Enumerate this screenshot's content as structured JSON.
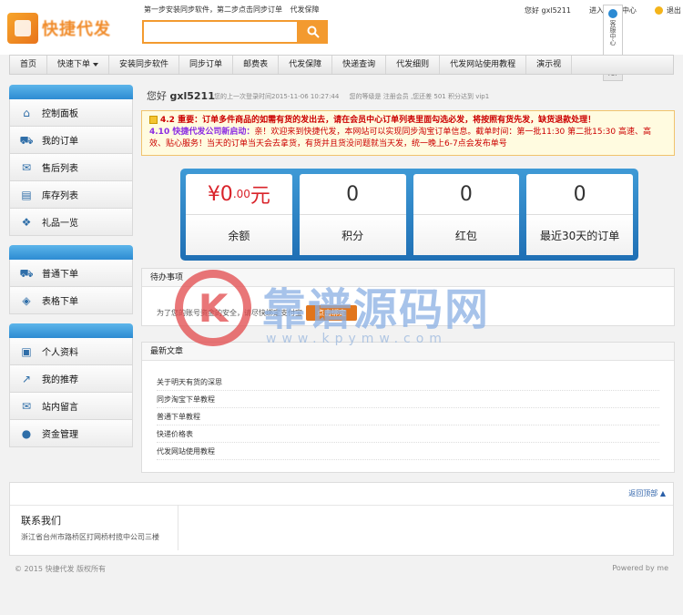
{
  "header": {
    "logo_text": "快捷代发",
    "tip_step": "第一步安装同步软件，第二步点击同步订单",
    "tip_link": "代发保障",
    "search_placeholder": "",
    "user_greeting": "您好 gxl5211",
    "enter_label": "进入",
    "center_label": "中心",
    "logout_label": "退出"
  },
  "service": {
    "label": "客服中心",
    "top": "TOP"
  },
  "nav": {
    "items": [
      "首页",
      "快速下单",
      "安装同步软件",
      "同步订单",
      "邮费表",
      "代发保障",
      "快递查询",
      "代发细则",
      "代发网站使用教程",
      "演示视"
    ]
  },
  "sidebar": {
    "group1": [
      "控制面板",
      "我的订单",
      "售后列表",
      "库存列表",
      "礼品一览"
    ],
    "group2": [
      "普通下单",
      "表格下单"
    ],
    "group3": [
      "个人资料",
      "我的推荐",
      "站内留言",
      "资金管理"
    ]
  },
  "main": {
    "greet_prefix": "您好",
    "username": "gxl5211",
    "last_login": "您的上一次登录时间2015-11-06 10:27:44",
    "level_info": "您的等级是 注册会员 ,您还差 501 积分达到 vip1",
    "notice1_tag": "4.2 重要：",
    "notice1_text": "订单多件商品的如需有货的发出去，请在会员中心订单列表里面勾选必发，将按照有货先发，缺货退款处理！",
    "notice2_tag": "4.10 快捷代发公司新启动：",
    "notice2_text": "亲！欢迎来到快捷代发，本网站可以实现同步淘宝订单信息。截单时间：第一批11:30 第二批15:30 高速、高效、贴心服务！当天的订单当天会去拿货，有货并且货没问题就当天发，统一晚上6-7点会发布单号",
    "stats": [
      {
        "value": "¥0",
        "decimal": ".00",
        "unit": "元",
        "label": "余额"
      },
      {
        "value": "0",
        "label": "积分"
      },
      {
        "value": "0",
        "label": "红包"
      },
      {
        "value": "0",
        "label": "最近30天的订单"
      }
    ],
    "todo_title": "待办事项",
    "todo_text": "为了您的账号资金的安全，请尽快绑定支付宝",
    "todo_button": "点击绑定",
    "articles_title": "最新文章",
    "articles": [
      "关于明天有货的深思",
      "同步淘宝下单教程",
      "普通下单教程",
      "快递价格表",
      "代发网站使用教程"
    ]
  },
  "watermark": {
    "letter": "K",
    "text": "靠谱源码网",
    "url": "www.kpymw.com"
  },
  "footer": {
    "back_top": "返回顶部",
    "contact_title": "联系我们",
    "contact_addr": "浙江省台州市路桥区打网桥村揽中公司三楼",
    "copyright": "© 2015 快捷代发 版权所有",
    "powered": "Powered by me"
  },
  "colors": {
    "accent": "#f39a2f",
    "blue": "#2d8bd2",
    "red": "#d9232a"
  }
}
